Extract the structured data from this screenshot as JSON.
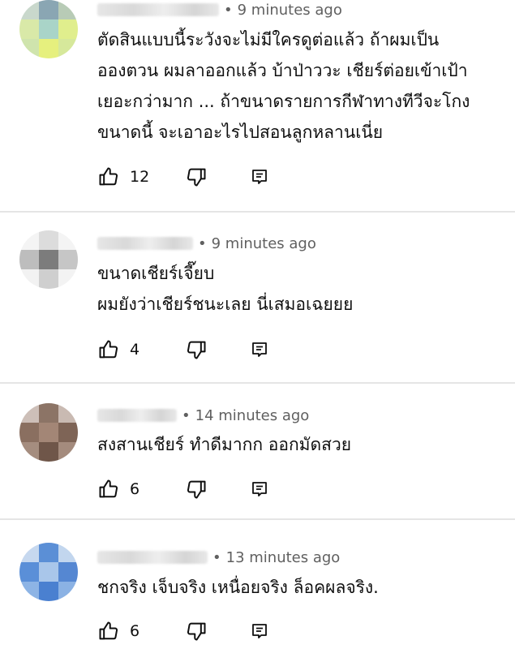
{
  "comments": [
    {
      "timestamp": "9 minutes ago",
      "text_lines": [
        "ตัดสินแบบนี้ระวังจะไม่มีใครดูต่อแล้ว ถ้าผมเป็น",
        "อองตวน ผมลาออกแล้ว บ้าป่าววะ เชียร์ต่อยเข้าเป้า",
        "เยอะกว่ามาก ... ถ้าขนาดรายการกีฬาทางทีวีจะโกง",
        "ขนาดนี้ จะเอาอะไรไปสอนลูกหลานเนี่ย"
      ],
      "likes": "12"
    },
    {
      "timestamp": "9 minutes ago",
      "text_lines": [
        "ขนาดเชียร์เจี๊ยบ",
        "ผมยังว่าเชียร์ชนะเลย  นี่เสมอเฉยยย"
      ],
      "likes": "4"
    },
    {
      "timestamp": "14 minutes ago",
      "text_lines": [
        "สงสานเชียร์ ทำดีมากก ออกมัดสวย"
      ],
      "likes": "6"
    },
    {
      "timestamp": "13 minutes ago",
      "text_lines": [
        "ชกจริง เจ็บจริง เหนื่อยจริง ล็อคผลจริง."
      ],
      "likes": "6"
    }
  ],
  "meta_separator": "•",
  "icons": {
    "like": "thumbs-up-icon",
    "dislike": "thumbs-down-icon",
    "reply": "reply-icon"
  },
  "colors": {
    "text": "#0f0f0f",
    "secondary_text": "#606060",
    "divider": "#e5e5e5"
  }
}
